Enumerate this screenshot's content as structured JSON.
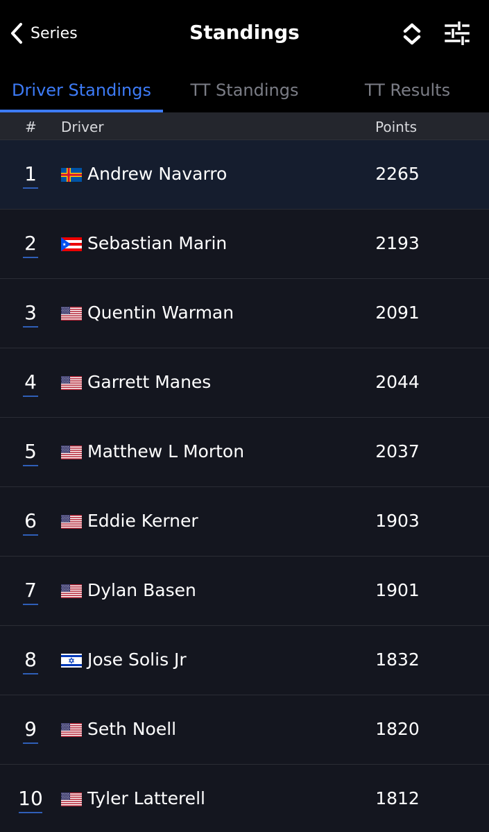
{
  "nav": {
    "back_label": "Series",
    "title": "Standings",
    "sort_icon": "sort-updown-icon",
    "filter_icon": "sliders-icon"
  },
  "tabs": [
    {
      "label": "Driver Standings",
      "active": true
    },
    {
      "label": "TT Standings",
      "active": false
    },
    {
      "label": "TT Results",
      "active": false
    }
  ],
  "columns": {
    "pos": "#",
    "driver": "Driver",
    "points": "Points"
  },
  "standings": [
    {
      "pos": "1",
      "name": "Andrew Navarro",
      "points": "2265",
      "flag": "aland-flag-icon"
    },
    {
      "pos": "2",
      "name": "Sebastian Marin",
      "points": "2193",
      "flag": "puerto-rico-flag-icon"
    },
    {
      "pos": "3",
      "name": "Quentin Warman",
      "points": "2091",
      "flag": "usa-flag-icon"
    },
    {
      "pos": "4",
      "name": "Garrett Manes",
      "points": "2044",
      "flag": "usa-flag-icon"
    },
    {
      "pos": "5",
      "name": "Matthew L Morton",
      "points": "2037",
      "flag": "usa-flag-icon"
    },
    {
      "pos": "6",
      "name": "Eddie Kerner",
      "points": "1903",
      "flag": "usa-flag-icon"
    },
    {
      "pos": "7",
      "name": "Dylan Basen",
      "points": "1901",
      "flag": "usa-flag-icon"
    },
    {
      "pos": "8",
      "name": "Jose Solis Jr",
      "points": "1832",
      "flag": "israel-flag-icon"
    },
    {
      "pos": "9",
      "name": "Seth Noell",
      "points": "1820",
      "flag": "usa-flag-icon"
    },
    {
      "pos": "10",
      "name": "Tyler Latterell",
      "points": "1812",
      "flag": "usa-flag-icon"
    }
  ],
  "colors": {
    "accent": "#3d7bf7",
    "background": "#14161f",
    "header_bg": "#000000",
    "highlight_row": "#151d2e"
  }
}
